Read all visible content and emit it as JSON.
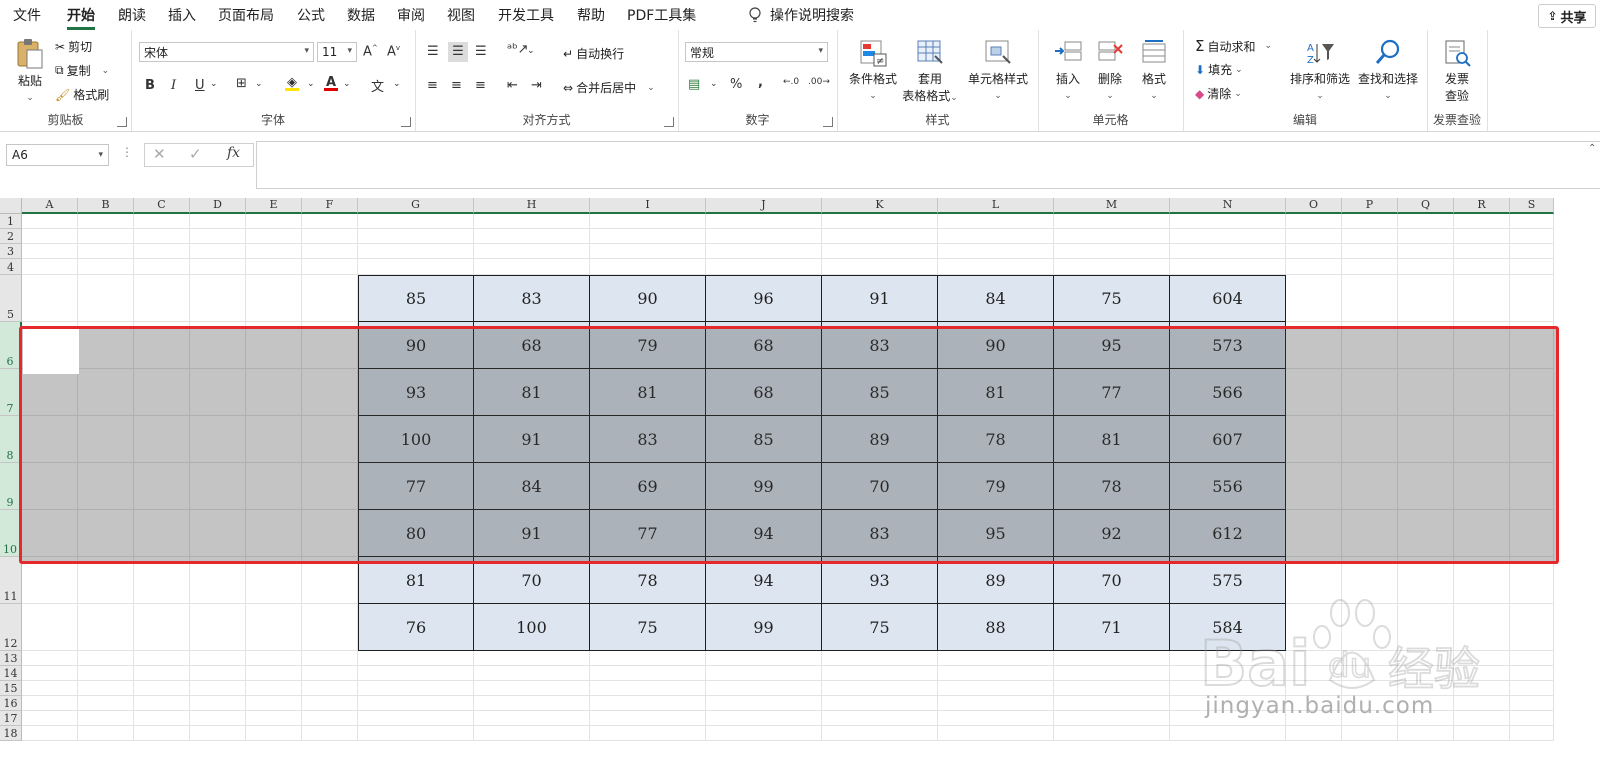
{
  "menu": {
    "tabs": [
      "文件",
      "开始",
      "朗读",
      "插入",
      "页面布局",
      "公式",
      "数据",
      "审阅",
      "视图",
      "开发工具",
      "帮助",
      "PDF工具集"
    ],
    "active": "开始",
    "search": "操作说明搜索",
    "share": "共享"
  },
  "ribbon": {
    "clipboard": {
      "label": "剪贴板",
      "paste": "粘贴",
      "cut": "剪切",
      "copy": "复制",
      "format_painter": "格式刷"
    },
    "font": {
      "label": "字体",
      "name": "宋体",
      "size": "11",
      "bold": "B",
      "italic": "I",
      "underline": "U"
    },
    "alignment": {
      "label": "对齐方式",
      "wrap": "自动换行",
      "merge": "合并后居中"
    },
    "number": {
      "label": "数字",
      "format": "常规",
      "percent": "%",
      "comma": ","
    },
    "styles": {
      "label": "样式",
      "conditional": "条件格式",
      "table_line1": "套用",
      "table_line2": "表格格式",
      "cell_style": "单元格样式"
    },
    "cells": {
      "label": "单元格",
      "insert": "插入",
      "delete": "删除",
      "format": "格式"
    },
    "editing": {
      "label": "编辑",
      "autosum": "自动求和",
      "fill": "填充",
      "clear": "清除",
      "sort_filter": "排序和筛选",
      "find_select": "查找和选择"
    },
    "invoice": {
      "label": "发票查验",
      "btn_line1": "发票",
      "btn_line2": "查验"
    }
  },
  "formula_bar": {
    "name_box": "A6",
    "fx": "fx",
    "formula": ""
  },
  "columns": [
    "A",
    "B",
    "C",
    "D",
    "E",
    "F",
    "G",
    "H",
    "I",
    "J",
    "K",
    "L",
    "M",
    "N",
    "O",
    "P",
    "Q",
    "R",
    "S"
  ],
  "rows": [
    "1",
    "2",
    "3",
    "4",
    "5",
    "6",
    "7",
    "8",
    "9",
    "10",
    "11",
    "12",
    "13",
    "14",
    "15",
    "16",
    "17",
    "18"
  ],
  "selected_rows": [
    "6",
    "7",
    "8",
    "9",
    "10"
  ],
  "table": [
    [
      "85",
      "83",
      "90",
      "96",
      "91",
      "84",
      "75",
      "604"
    ],
    [
      "90",
      "68",
      "79",
      "68",
      "83",
      "90",
      "95",
      "573"
    ],
    [
      "93",
      "81",
      "81",
      "68",
      "85",
      "81",
      "77",
      "566"
    ],
    [
      "100",
      "91",
      "83",
      "85",
      "89",
      "78",
      "81",
      "607"
    ],
    [
      "77",
      "84",
      "69",
      "99",
      "70",
      "79",
      "78",
      "556"
    ],
    [
      "80",
      "91",
      "77",
      "94",
      "83",
      "95",
      "92",
      "612"
    ],
    [
      "81",
      "70",
      "78",
      "94",
      "93",
      "89",
      "70",
      "575"
    ],
    [
      "76",
      "100",
      "75",
      "99",
      "75",
      "88",
      "71",
      "584"
    ]
  ],
  "colors": {
    "table_fill": "#dde6f0",
    "accent": "#217346",
    "highlight": "#e5282c"
  },
  "watermark": {
    "logo": "Bai du 经验",
    "url": "jingyan.baidu.com"
  }
}
